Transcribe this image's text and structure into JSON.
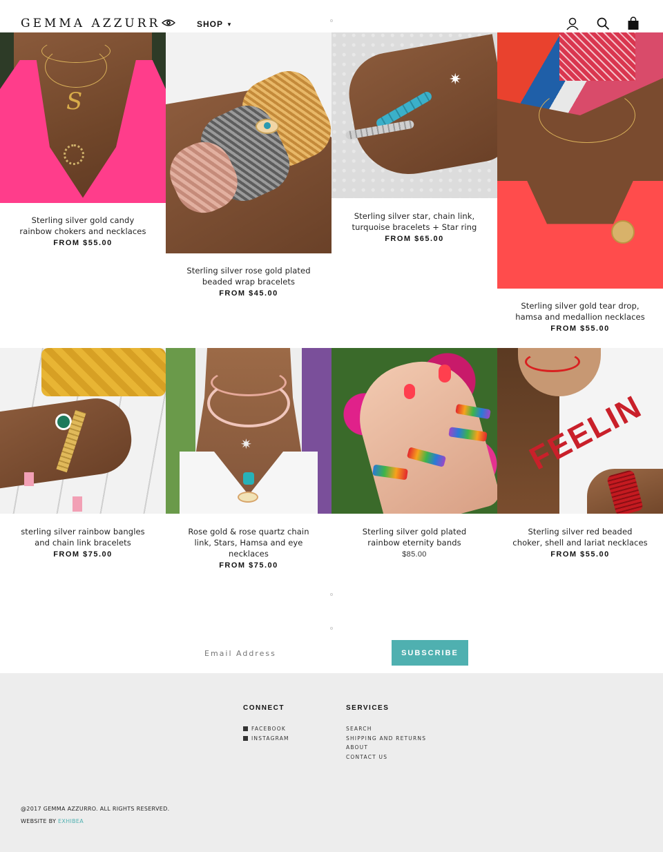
{
  "brand": {
    "logo_text": "Gemma Azzurr"
  },
  "nav": {
    "shop_label": "SHOP"
  },
  "icons": {
    "account": "user-icon",
    "search": "search-icon",
    "cart": "shopping-bag-icon"
  },
  "colors": {
    "accent": "#4fb0b0",
    "footer_bg": "#ededed",
    "text": "#111111"
  },
  "products": [
    {
      "title": "Sterling silver gold candy rainbow chokers and necklaces",
      "price": "FROM $55.00"
    },
    {
      "title": "Sterling silver rose gold plated beaded wrap bracelets",
      "price": "FROM $45.00"
    },
    {
      "title": "Sterling silver star, chain link, turquoise bracelets + Star ring",
      "price": "FROM $65.00"
    },
    {
      "title": "Sterling silver gold tear drop, hamsa and medallion necklaces",
      "price": "FROM $55.00"
    },
    {
      "title": "sterling silver rainbow bangles and chain link bracelets",
      "price": "FROM $75.00"
    },
    {
      "title": "Rose gold & rose quartz chain link, Stars, Hamsa and eye necklaces",
      "price": "FROM $75.00"
    },
    {
      "title": "Sterling silver gold plated rainbow eternity bands",
      "price": "$85.00"
    },
    {
      "title": "Sterling silver red beaded choker, shell and lariat necklaces",
      "price": "FROM $55.00"
    }
  ],
  "newsletter": {
    "placeholder": "Email Address",
    "button": "SUBSCRIBE"
  },
  "footer": {
    "connect": {
      "heading": "CONNECT",
      "links": [
        "FACEBOOK",
        "INSTAGRAM"
      ]
    },
    "services": {
      "heading": "SERVICES",
      "links": [
        "SEARCH",
        "SHIPPING AND RETURNS",
        "ABOUT",
        "CONTACT US"
      ]
    },
    "copyright": "@2017 GEMMA AZZURRO. ALL RIGHTS RESERVED.",
    "credit_prefix": "WEBSITE BY",
    "credit_link": "EXHIBEA"
  }
}
